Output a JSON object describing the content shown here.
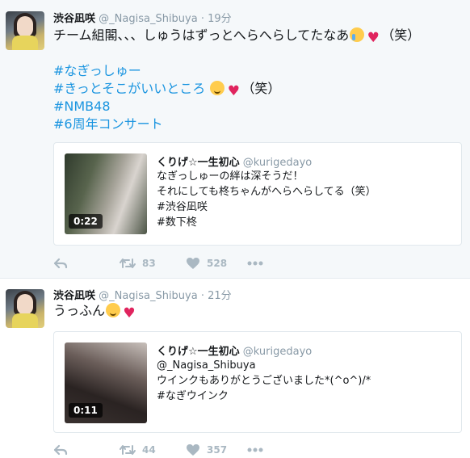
{
  "tweets": [
    {
      "author_name": "渋谷凪咲",
      "handle": "@_Nagisa_Shibuya",
      "separator": "·",
      "time": "19分",
      "text_line1": "チーム組閣、、、しゅうはずっとへらへらしてたなあ",
      "text_line1_suffix": "（笑）",
      "hashtags": [
        "#なぎっしゅー",
        "#きっとそこがいいところ",
        "#NMB48",
        "#6周年コンサート"
      ],
      "hashtag_suffix": "（笑）",
      "quote": {
        "author_name": "くりげ☆一生初心",
        "handle": "@kurigedayo",
        "lines": [
          "なぎっしゅーの絆は深そうだ！",
          "それにしても柊ちゃんがへらへらしてる（笑）",
          " #渋谷凪咲",
          "#数下柊"
        ],
        "duration": "0:22"
      },
      "retweets": "83",
      "likes": "528"
    },
    {
      "author_name": "渋谷凪咲",
      "handle": "@_Nagisa_Shibuya",
      "separator": "·",
      "time": "21分",
      "text_line1": "うっふん",
      "quote": {
        "author_name": "くりげ☆一生初心",
        "handle": "@kurigedayo",
        "lines": [
          "@_Nagisa_Shibuya",
          "ウインクもありがとうございました*(^o^)/*",
          "#なぎウインク"
        ],
        "duration": "0:11"
      },
      "retweets": "44",
      "likes": "357"
    }
  ],
  "icons": [
    "reply-icon",
    "retweet-icon",
    "heart-icon",
    "more-icon",
    "crying-face-emoji",
    "heart-emoji",
    "smiling-face-emoji",
    "winking-face-emoji"
  ],
  "colors": {
    "hashtag": "#1b95e0",
    "muted": "#8899a6",
    "action": "#aab8c2",
    "highlight_bg": "#f5f8fa"
  }
}
